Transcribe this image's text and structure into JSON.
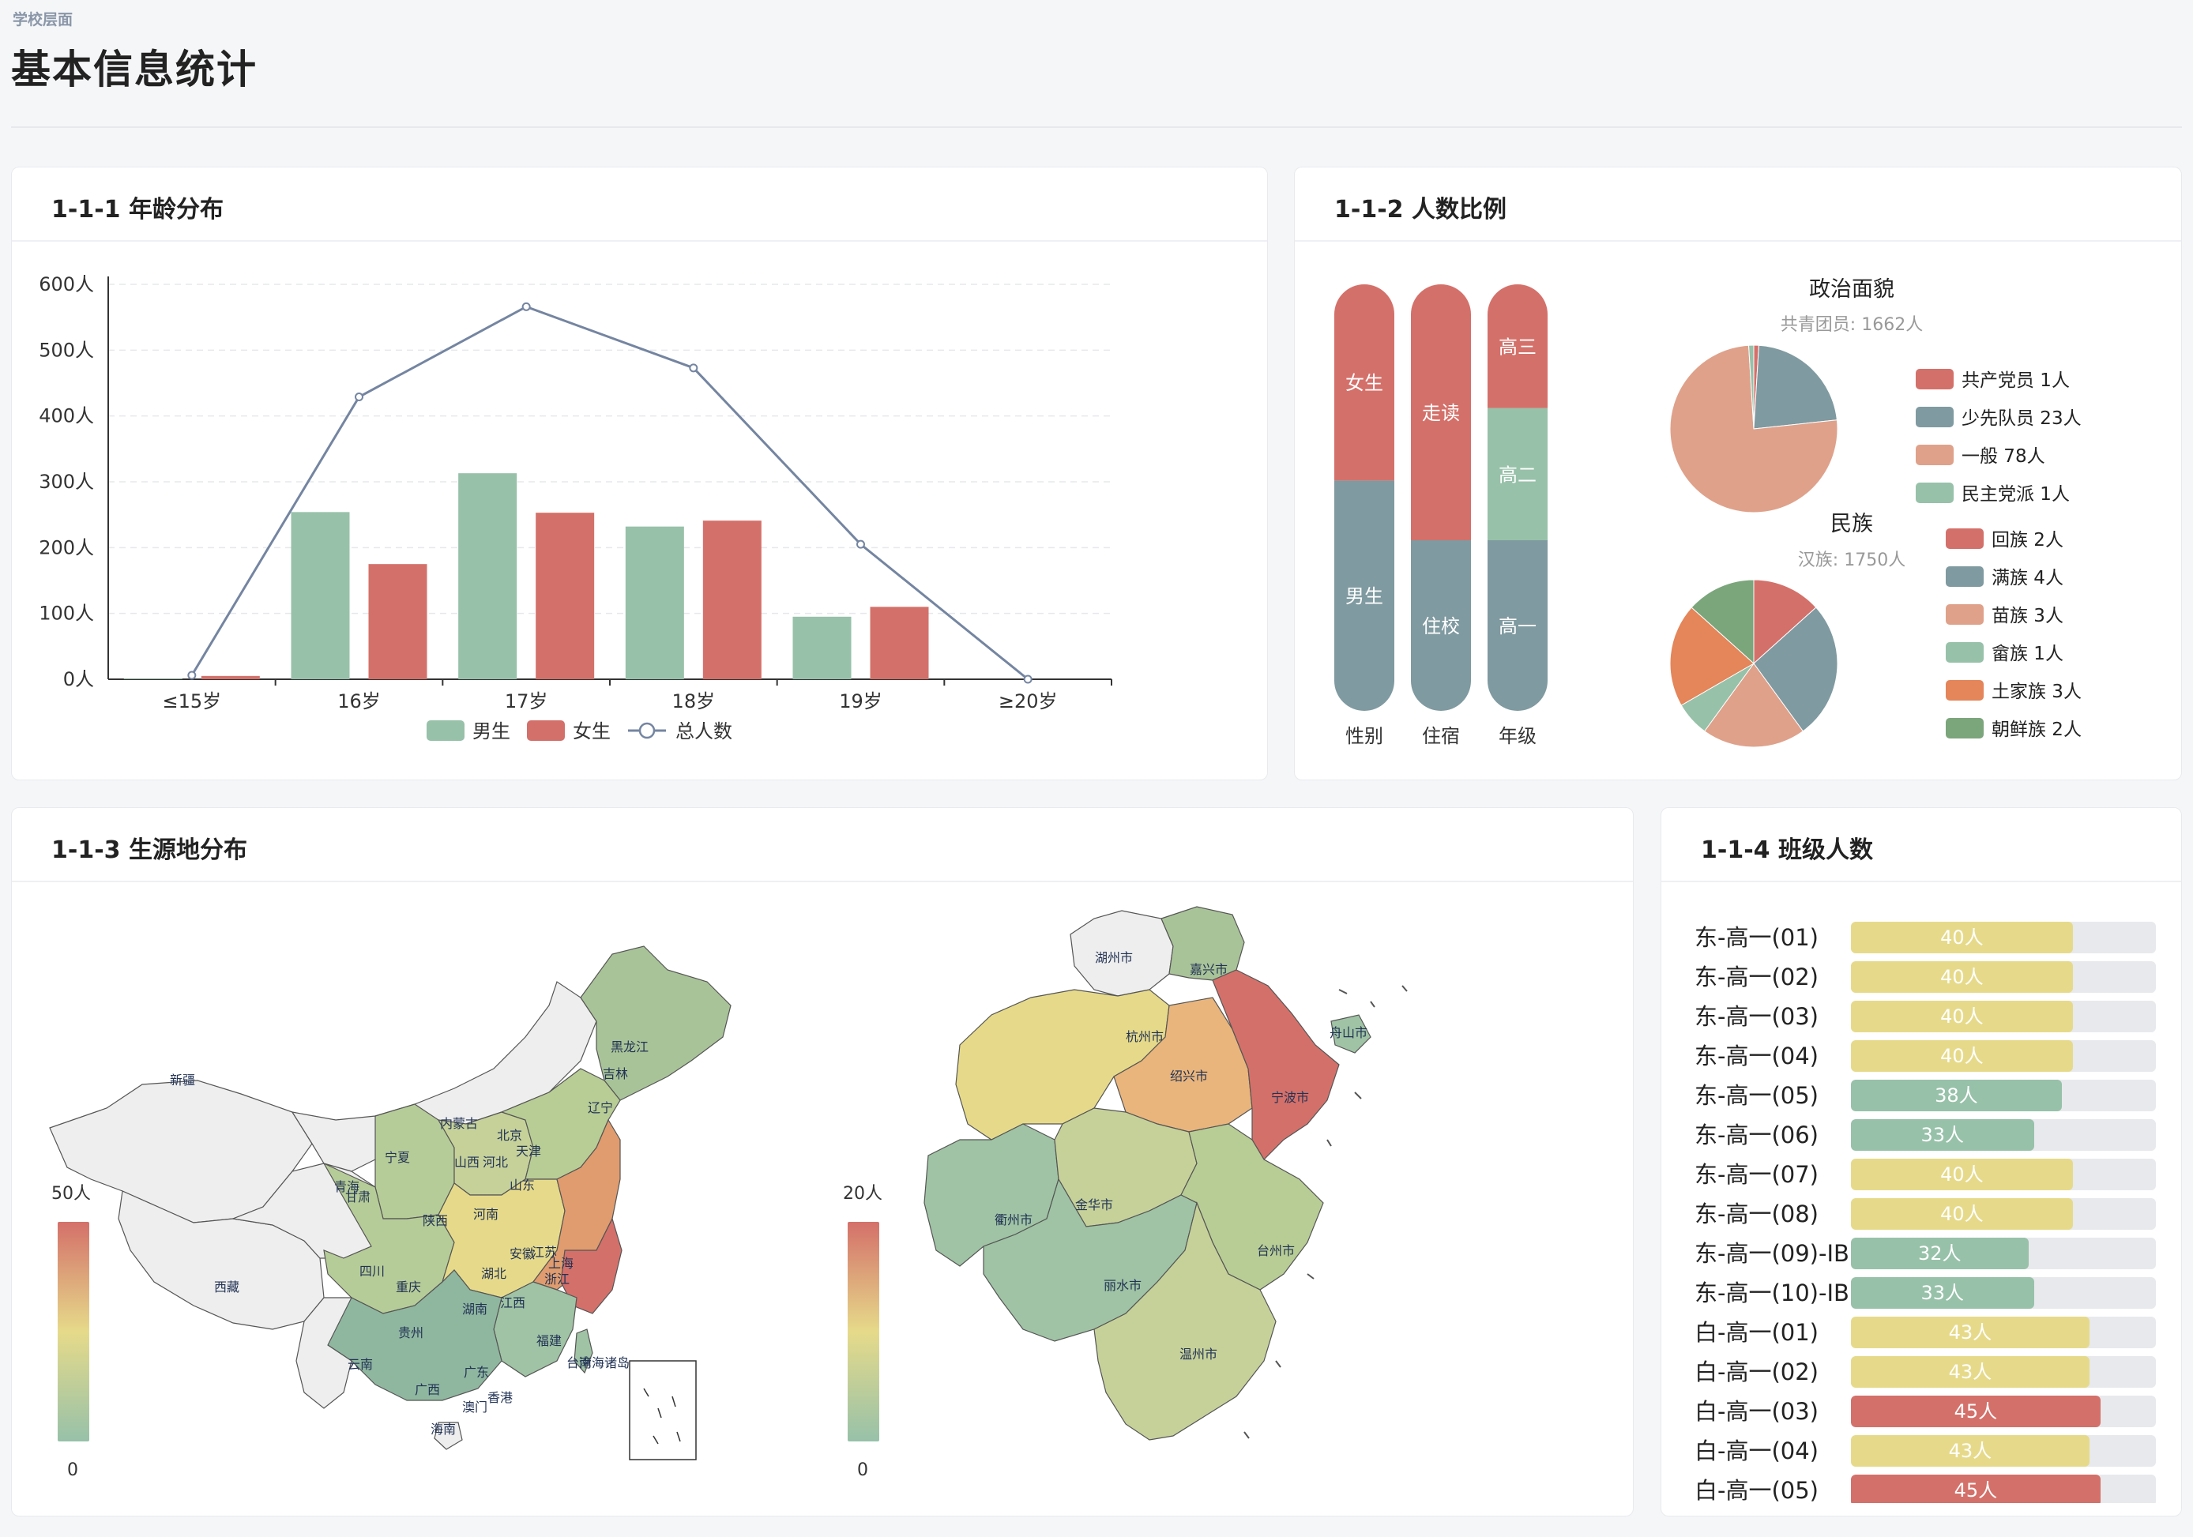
{
  "header": {
    "breadcrumb": "学校层面",
    "title": "基本信息统计"
  },
  "colors": {
    "green": "#97c1a9",
    "red": "#d4706a",
    "slate": "#7f9aa0",
    "peach": "#dfa18a",
    "yellow": "#e6da8a",
    "orange": "#e4855a",
    "darkgreen": "#7ba57b",
    "line": "#7485a1"
  },
  "age_card": {
    "title": "1-1-1 年龄分布",
    "chart_data": {
      "type": "bar",
      "categories": [
        "≤15岁",
        "16岁",
        "17岁",
        "18岁",
        "19岁",
        "≥20岁"
      ],
      "series": [
        {
          "name": "男生",
          "values": [
            1,
            254,
            313,
            232,
            95,
            0
          ],
          "color": "#97c1a9"
        },
        {
          "name": "女生",
          "values": [
            5,
            175,
            253,
            241,
            110,
            0
          ],
          "color": "#d4706a"
        },
        {
          "name": "总人数",
          "type": "line",
          "values": [
            6,
            429,
            566,
            473,
            205,
            0
          ],
          "color": "#7485a1"
        }
      ],
      "yticks": [
        "0人",
        "100人",
        "200人",
        "300人",
        "400人",
        "500人",
        "600人"
      ],
      "ylim": [
        0,
        600
      ]
    }
  },
  "ratio_card": {
    "title": "1-1-2 人数比例",
    "bars": [
      {
        "label": "性别",
        "segments": [
          {
            "name": "男生",
            "value": 0.54,
            "color": "#7f9aa0"
          },
          {
            "name": "女生",
            "value": 0.46,
            "color": "#d4706a"
          }
        ]
      },
      {
        "label": "住宿",
        "segments": [
          {
            "name": "住校",
            "value": 0.4,
            "color": "#7f9aa0"
          },
          {
            "name": "走读",
            "value": 0.6,
            "color": "#d4706a"
          }
        ]
      },
      {
        "label": "年级",
        "segments": [
          {
            "name": "高一",
            "value": 0.4,
            "color": "#7f9aa0"
          },
          {
            "name": "高二",
            "value": 0.31,
            "color": "#97c1a9"
          },
          {
            "name": "高三",
            "value": 0.29,
            "color": "#d4706a"
          }
        ]
      }
    ],
    "political": {
      "title": "政治面貌",
      "subtitle": "共青团员: 1662人",
      "chart_data": {
        "type": "pie",
        "slices": [
          {
            "name": "共青团员",
            "value": 1662,
            "color": "#7f9aa0",
            "legend": false
          },
          {
            "name": "共产党员",
            "value": 1,
            "color": "#d4706a",
            "legend": "共产党员 1人"
          },
          {
            "name": "少先队员",
            "value": 23,
            "color": "#7f9aa0",
            "legend": "少先队员 23人"
          },
          {
            "name": "一般",
            "value": 78,
            "color": "#dfa18a",
            "legend": "一般 78人"
          },
          {
            "name": "民主党派",
            "value": 1,
            "color": "#97c1a9",
            "legend": "民主党派 1人"
          }
        ]
      }
    },
    "ethnic": {
      "title": "民族",
      "subtitle": "汉族: 1750人",
      "chart_data": {
        "type": "pie",
        "slices": [
          {
            "name": "回族",
            "value": 2,
            "color": "#d4706a",
            "legend": "回族 2人"
          },
          {
            "name": "满族",
            "value": 4,
            "color": "#7f9aa0",
            "legend": "满族 4人"
          },
          {
            "name": "苗族",
            "value": 3,
            "color": "#dfa18a",
            "legend": "苗族 3人"
          },
          {
            "name": "畲族",
            "value": 1,
            "color": "#97c1a9",
            "legend": "畲族 1人"
          },
          {
            "name": "土家族",
            "value": 3,
            "color": "#e4855a",
            "legend": "土家族 3人"
          },
          {
            "name": "朝鲜族",
            "value": 2,
            "color": "#7ba57b",
            "legend": "朝鲜族 2人"
          }
        ]
      }
    }
  },
  "origin_card": {
    "title": "1-1-3 生源地分布",
    "china_scale": {
      "max": "50人",
      "min": "0"
    },
    "zj_scale": {
      "max": "20人",
      "min": "0"
    },
    "china_labels": [
      "新疆",
      "西藏",
      "青海",
      "甘肃",
      "宁夏",
      "内蒙古",
      "黑龙江",
      "吉林",
      "辽宁",
      "北京",
      "天津",
      "河北",
      "山西",
      "山东",
      "陕西",
      "河南",
      "四川",
      "重庆",
      "湖北",
      "安徽",
      "江苏",
      "上海",
      "浙江",
      "湖南",
      "江西",
      "福建",
      "贵州",
      "云南",
      "广西",
      "广东",
      "香港",
      "澳门",
      "台湾",
      "海南",
      "南海诸岛"
    ],
    "zj_labels": [
      "湖州市",
      "嘉兴市",
      "杭州市",
      "舟山市",
      "绍兴市",
      "宁波市",
      "衢州市",
      "金华市",
      "台州市",
      "丽水市",
      "温州市"
    ]
  },
  "class_card": {
    "title": "1-1-4 班级人数",
    "max": 55,
    "rows": [
      {
        "label": "东-高一(01)",
        "value": "40人",
        "n": 40,
        "color": "#e6da8a"
      },
      {
        "label": "东-高一(02)",
        "value": "40人",
        "n": 40,
        "color": "#e6da8a"
      },
      {
        "label": "东-高一(03)",
        "value": "40人",
        "n": 40,
        "color": "#e6da8a"
      },
      {
        "label": "东-高一(04)",
        "value": "40人",
        "n": 40,
        "color": "#e6da8a"
      },
      {
        "label": "东-高一(05)",
        "value": "38人",
        "n": 38,
        "color": "#97c1a9"
      },
      {
        "label": "东-高一(06)",
        "value": "33人",
        "n": 33,
        "color": "#97c1a9"
      },
      {
        "label": "东-高一(07)",
        "value": "40人",
        "n": 40,
        "color": "#e6da8a"
      },
      {
        "label": "东-高一(08)",
        "value": "40人",
        "n": 40,
        "color": "#e6da8a"
      },
      {
        "label": "东-高一(09)-IB",
        "value": "32人",
        "n": 32,
        "color": "#97c1a9"
      },
      {
        "label": "东-高一(10)-IB",
        "value": "33人",
        "n": 33,
        "color": "#97c1a9"
      },
      {
        "label": "白-高一(01)",
        "value": "43人",
        "n": 43,
        "color": "#e6da8a"
      },
      {
        "label": "白-高一(02)",
        "value": "43人",
        "n": 43,
        "color": "#e6da8a"
      },
      {
        "label": "白-高一(03)",
        "value": "45人",
        "n": 45,
        "color": "#d4706a"
      },
      {
        "label": "白-高一(04)",
        "value": "43人",
        "n": 43,
        "color": "#e6da8a"
      },
      {
        "label": "白-高一(05)",
        "value": "45人",
        "n": 45,
        "color": "#d4706a"
      }
    ]
  }
}
